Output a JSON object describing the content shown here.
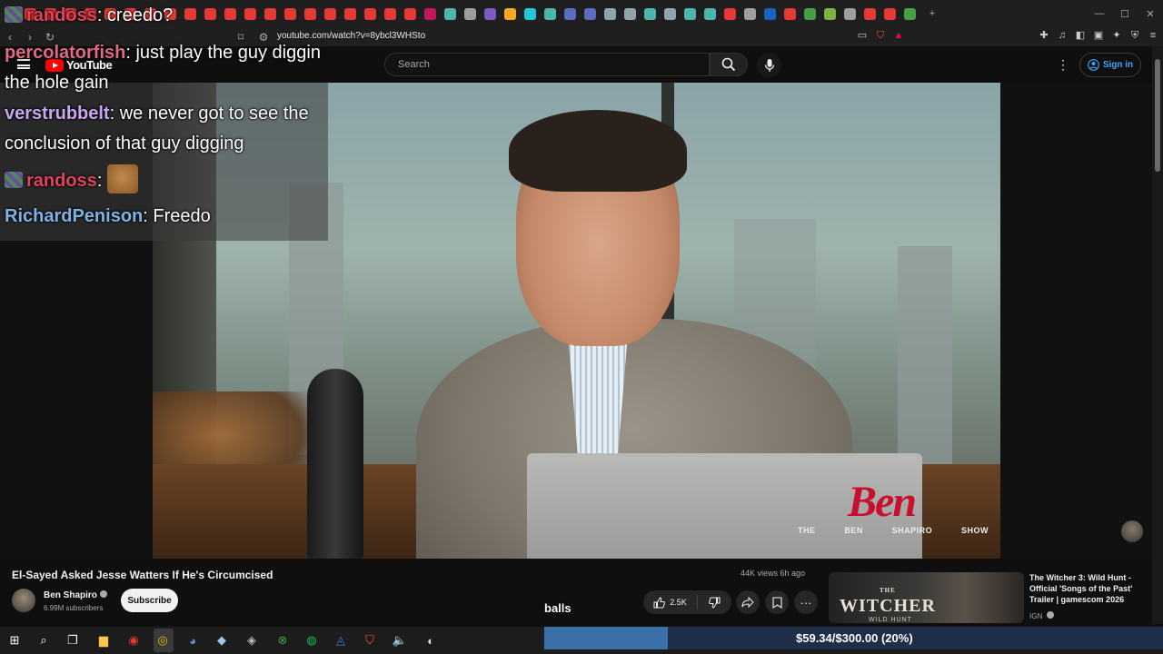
{
  "browser": {
    "url": "youtube.com/watch?v=8ybcl3WHSto"
  },
  "youtube": {
    "logo_text": "YouTube",
    "search_placeholder": "Search",
    "signin_label": "Sign in"
  },
  "chat": [
    {
      "user": "randoss",
      "message": ": creedo?",
      "user_color": "#e0435b",
      "badge": true
    },
    {
      "user": "percolatorfish",
      "message": ": just play the guy diggin the hole gain",
      "user_color": "#e06a86"
    },
    {
      "user": "verstrubbelt",
      "message": ": we never got to see the conclusion of that guy digging",
      "user_color": "#c9a6f2"
    },
    {
      "user": "randoss",
      "message": ": ",
      "user_color": "#e0435b",
      "badge": true,
      "emote": "cat-emote"
    },
    {
      "user": "RichardPenison",
      "message": ": Freedo",
      "user_color": "#7fb3e6"
    }
  ],
  "video": {
    "overlay_logo": "Ben",
    "overlay_words": [
      "THE",
      "BEN",
      "SHAPIRO",
      "SHOW"
    ],
    "title": "El-Sayed Asked Jesse Watters If He's Circumcised",
    "meta": "44K views  6h ago",
    "channel": "Ben Shapiro",
    "subscribers": "6.99M subscribers",
    "subscribe_label": "Subscribe",
    "likes": "2.5K"
  },
  "overlay_caption": "balls",
  "recommended": {
    "thumb_text": "WITCHER",
    "thumb_the": "THE",
    "thumb_sub": "WILD HUNT",
    "title": "The Witcher 3: Wild Hunt - Official 'Songs of the Past' Trailer | gamescom 2026",
    "channel": "IGN"
  },
  "donation": {
    "text": "$59.34/$300.00 (20%)",
    "progress": 0.2
  },
  "colors": {
    "accent_link": "#3ea6ff",
    "yt_red": "#ff0000",
    "ben_red": "#c8102e"
  }
}
